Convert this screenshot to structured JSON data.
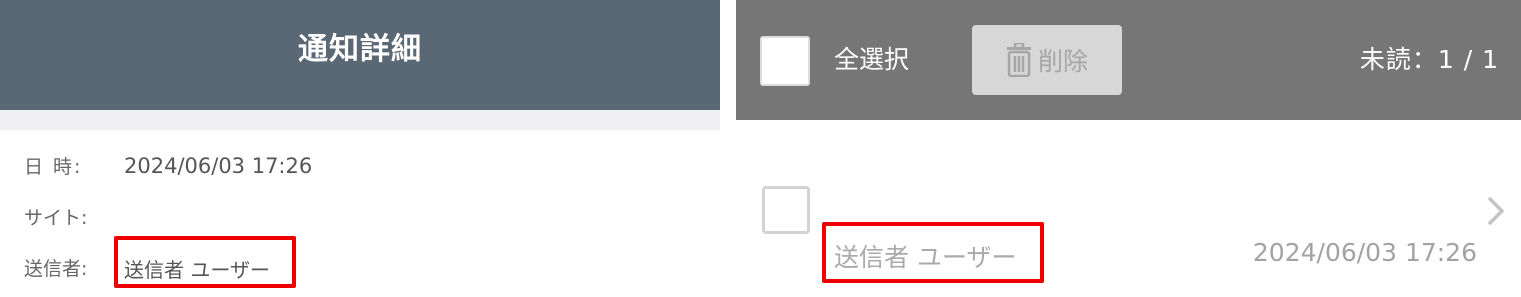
{
  "detail": {
    "title": "通知詳細",
    "datetime_label": "日 時:",
    "datetime_value": "2024/06/03 17:26",
    "site_label": "サイト:",
    "site_value": "",
    "sender_label": "送信者:",
    "sender_value": "送信者 ユーザー"
  },
  "list": {
    "select_all_label": "全選択",
    "delete_label": "削除",
    "unread_label": "未読：1 / 1",
    "items": [
      {
        "sender": "送信者 ユーザー",
        "date": "2024/06/03 17:26"
      }
    ]
  },
  "colors": {
    "detail_header": "#5a6775",
    "list_toolbar": "#767676",
    "highlight": "#ee0000"
  },
  "icons": [
    "trash-icon",
    "chevron-right-icon"
  ]
}
